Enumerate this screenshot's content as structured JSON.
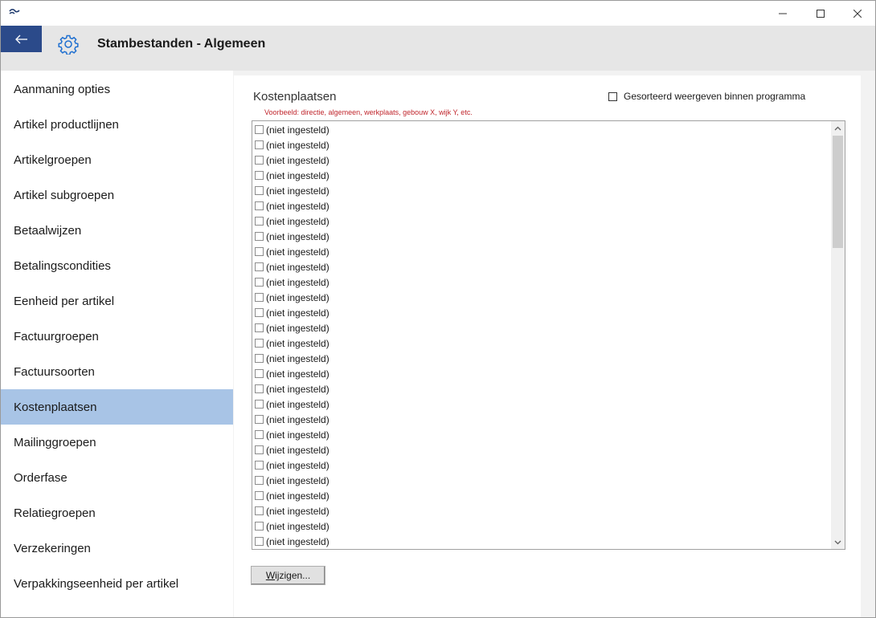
{
  "window": {
    "title": "",
    "controls": [
      "minimize-icon",
      "maximize-icon",
      "close-icon"
    ]
  },
  "header": {
    "title": "Stambestanden - Algemeen",
    "back_icon": "arrow-left-icon",
    "settings_icon": "gear-icon",
    "back_bg": "#2b4a8a"
  },
  "sidebar": {
    "active_color": "#a8c4e6",
    "items": [
      {
        "label": "Aanmaning opties"
      },
      {
        "label": "Artikel productlijnen"
      },
      {
        "label": "Artikelgroepen"
      },
      {
        "label": "Artikel subgroepen"
      },
      {
        "label": "Betaalwijzen"
      },
      {
        "label": "Betalingscondities"
      },
      {
        "label": "Eenheid per artikel"
      },
      {
        "label": "Factuurgroepen"
      },
      {
        "label": "Factuursoorten"
      },
      {
        "label": "Kostenplaatsen",
        "active": true
      },
      {
        "label": "Mailinggroepen"
      },
      {
        "label": "Orderfase"
      },
      {
        "label": "Relatiegroepen"
      },
      {
        "label": "Verzekeringen"
      },
      {
        "label": "Verpakkingseenheid per artikel"
      }
    ]
  },
  "main": {
    "section_title": "Kostenplaatsen",
    "example": "Voorbeeld: directie, algemeen, werkplaats, gebouw X, wijk Y, etc.",
    "example_color": "#c0262d",
    "sorted_option": {
      "label": "Gesorteerd weergeven binnen programma",
      "checked": false
    },
    "list": {
      "items": [
        "(niet ingesteld)",
        "(niet ingesteld)",
        "(niet ingesteld)",
        "(niet ingesteld)",
        "(niet ingesteld)",
        "(niet ingesteld)",
        "(niet ingesteld)",
        "(niet ingesteld)",
        "(niet ingesteld)",
        "(niet ingesteld)",
        "(niet ingesteld)",
        "(niet ingesteld)",
        "(niet ingesteld)",
        "(niet ingesteld)",
        "(niet ingesteld)",
        "(niet ingesteld)",
        "(niet ingesteld)",
        "(niet ingesteld)",
        "(niet ingesteld)",
        "(niet ingesteld)",
        "(niet ingesteld)",
        "(niet ingesteld)",
        "(niet ingesteld)",
        "(niet ingesteld)",
        "(niet ingesteld)",
        "(niet ingesteld)",
        "(niet ingesteld)",
        "(niet ingesteld)"
      ]
    },
    "change_button": {
      "prefix": "W",
      "rest": "ijzigen..."
    }
  }
}
